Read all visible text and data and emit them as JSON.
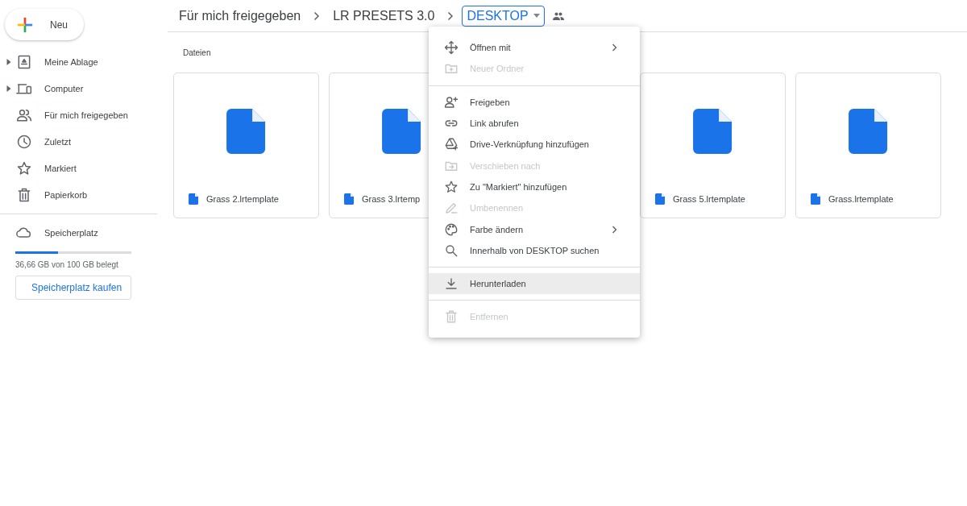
{
  "new_button": {
    "label": "Neu"
  },
  "sidebar": {
    "items": [
      {
        "label": "Meine Ablage",
        "expandable": true
      },
      {
        "label": "Computer",
        "expandable": true
      },
      {
        "label": "Für mich freigegeben",
        "expandable": false
      },
      {
        "label": "Zuletzt",
        "expandable": false
      },
      {
        "label": "Markiert",
        "expandable": false
      },
      {
        "label": "Papierkorb",
        "expandable": false
      }
    ],
    "storage": {
      "label": "Speicherplatz",
      "level": 0.37,
      "usage": "36,66 GB von 100 GB belegt",
      "buy_button": "Speicherplatz kaufen"
    }
  },
  "breadcrumb": [
    {
      "label": "Für mich freigegeben",
      "selected": false
    },
    {
      "label": "LR PRESETS 3.0",
      "selected": false
    },
    {
      "label": "DESKTOP",
      "selected": true
    }
  ],
  "section_title": "Dateien",
  "files": [
    {
      "name": "Grass 2.lrtemplate"
    },
    {
      "name": "Grass 3.lrtemp"
    },
    {
      "name": "Grass 5.lrtemplate"
    },
    {
      "name": "Grass.lrtemplate"
    }
  ],
  "context_menu": {
    "groups": [
      [
        {
          "label": "Öffnen mit",
          "disabled": false,
          "submenu": true,
          "selected": false
        },
        {
          "label": "Neuer Ordner",
          "disabled": true,
          "submenu": false,
          "selected": false
        }
      ],
      [
        {
          "label": "Freigeben",
          "disabled": false,
          "submenu": false,
          "selected": false
        },
        {
          "label": "Link abrufen",
          "disabled": false,
          "submenu": false,
          "selected": false
        },
        {
          "label": "Drive-Verknüpfung hinzufügen",
          "disabled": false,
          "submenu": false,
          "selected": false
        },
        {
          "label": "Verschieben nach",
          "disabled": true,
          "submenu": false,
          "selected": false
        },
        {
          "label": "Zu \"Markiert\" hinzufügen",
          "disabled": false,
          "submenu": false,
          "selected": false
        },
        {
          "label": "Umbenennen",
          "disabled": true,
          "submenu": false,
          "selected": false
        },
        {
          "label": "Farbe ändern",
          "disabled": false,
          "submenu": true,
          "selected": false
        },
        {
          "label": "Innerhalb von DESKTOP suchen",
          "disabled": false,
          "submenu": false,
          "selected": false
        }
      ],
      [
        {
          "label": "Herunterladen",
          "disabled": false,
          "submenu": false,
          "selected": true
        }
      ],
      [
        {
          "label": "Entfernen",
          "disabled": true,
          "submenu": false,
          "selected": false
        }
      ]
    ]
  }
}
